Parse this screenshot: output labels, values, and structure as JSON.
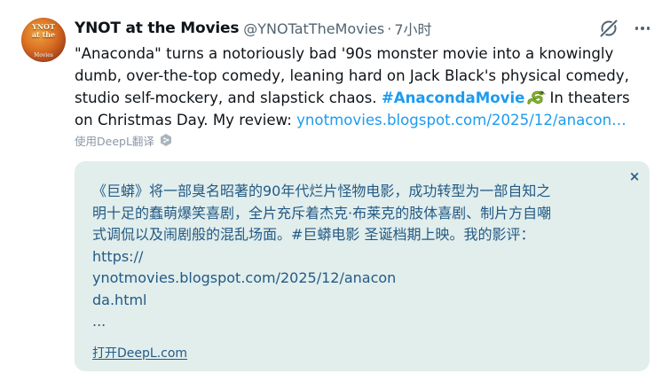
{
  "avatar": {
    "logo_text": "YNOT at the Movies"
  },
  "header": {
    "display_name": "YNOT at the Movies",
    "handle": "@YNOTatTheMovies",
    "separator": "·",
    "timestamp": "7小时"
  },
  "tweet": {
    "lines": [
      "\"Anaconda\" turns a notoriously bad '90s monster movie into a knowingly",
      "dumb, over-the-top comedy, leaning hard on Jack Black's physical comedy,",
      "studio self-mockery, and slapstick chaos."
    ],
    "hashtag": "#AnacondaMovie",
    "after_hashtag": "In theaters",
    "last_line_prefix": "on Christmas Day. My review:",
    "link_text": "ynotmovies.blogspot.com/2025/12/anacon…"
  },
  "translate_label": "使用DeepL翻译",
  "translation": {
    "lines": [
      "《巨蟒》将一部臭名昭著的90年代烂片怪物电影，成功转型为一部自知之",
      "明十足的蠢萌爆笑喜剧，全片充斥着杰克·布莱克的肢体喜剧、制片方自嘲",
      "式调侃以及闹剧般的混乱场面。#巨蟒电影 圣诞档期上映。我的影评：",
      "https://",
      "ynotmovies.blogspot.com/2025/12/anacon",
      "da.html",
      "..."
    ],
    "close_symbol": "×",
    "open_link_label": "打开DeepL.com"
  },
  "colors": {
    "link": "#1d9bf0",
    "card_bg": "#e1eeec",
    "translation_text": "#245a85",
    "secondary_text": "#536471"
  },
  "icons": {
    "grok": "grok-icon",
    "more": "more-horizontal-icon",
    "snake": "snake-emoji-icon",
    "deepl": "deepl-logo-icon",
    "close": "close-icon"
  }
}
